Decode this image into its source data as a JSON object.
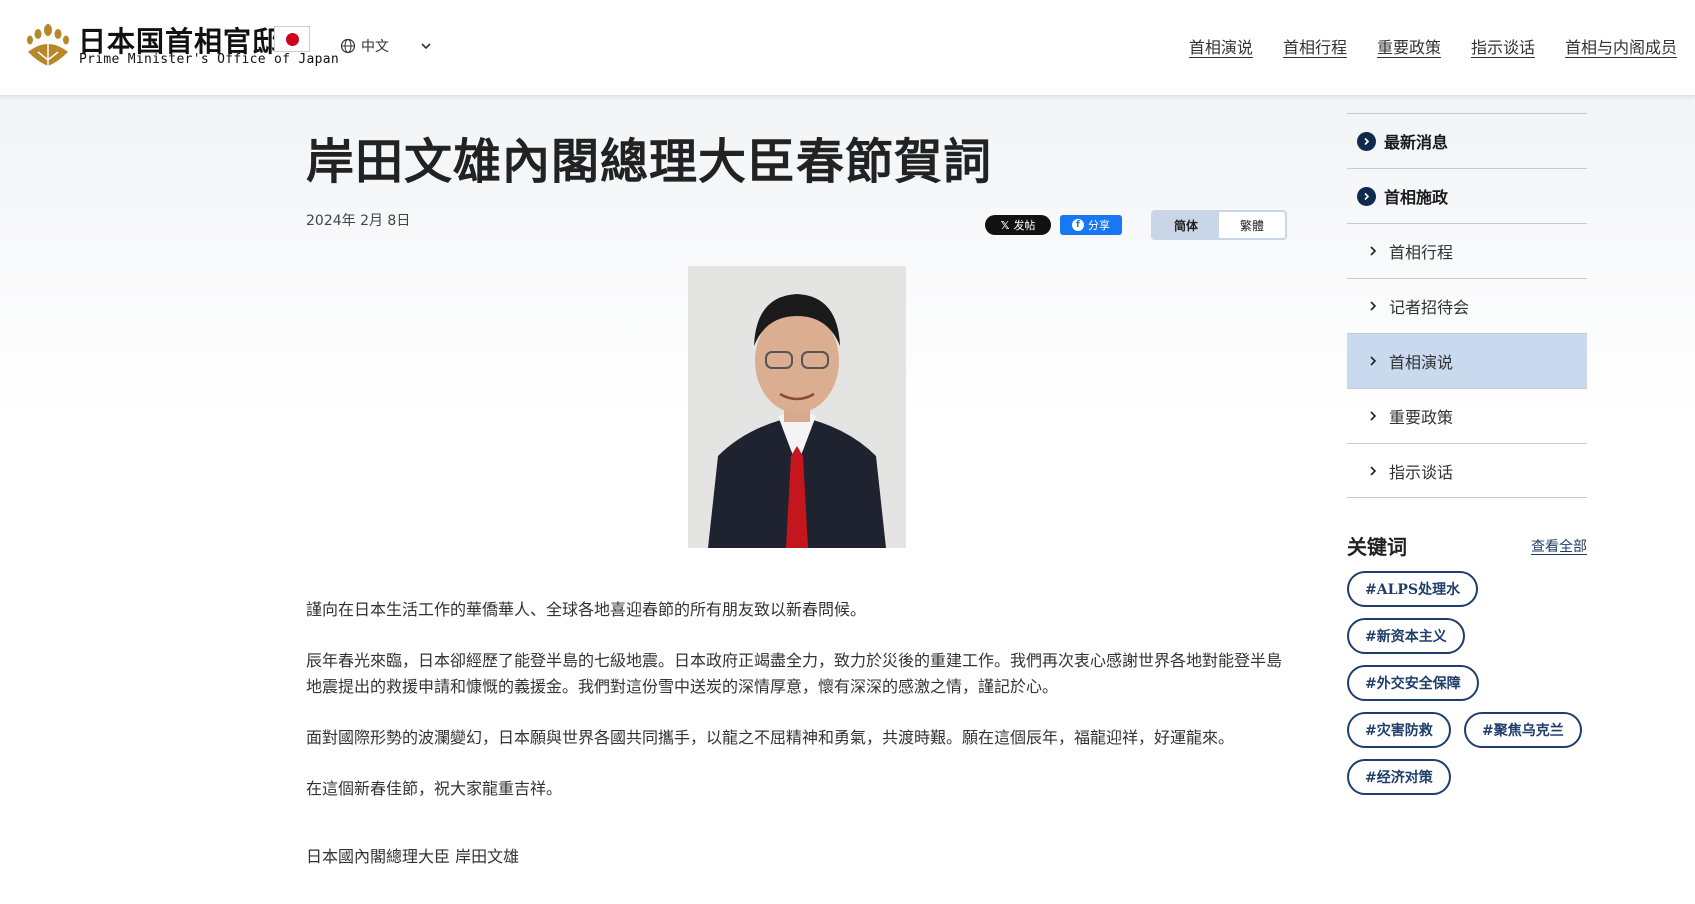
{
  "header": {
    "logo_title": "日本国首相官邸",
    "logo_subtitle": "Prime Minister's Office of Japan",
    "language": "中文",
    "nav": [
      "首相演说",
      "首相行程",
      "重要政策",
      "指示谈话",
      "首相与内阁成员"
    ]
  },
  "article": {
    "title": "岸田文雄內閣總理大臣春節賀詞",
    "date": "2024年 2月 8日",
    "share_x": "发帖",
    "share_fb": "分享",
    "script_simplified": "简体",
    "script_traditional": "繁體",
    "paragraphs": [
      "謹向在日本生活工作的華僑華人、全球各地喜迎春節的所有朋友致以新春問候。",
      "辰年春光來臨，日本卻經歷了能登半島的七級地震。日本政府正竭盡全力，致力於災後的重建工作。我們再次衷心感謝世界各地對能登半島地震提出的救援申請和慷慨的義援金。我們對這份雪中送炭的深情厚意，懷有深深的感激之情，謹記於心。",
      "面對國際形勢的波瀾變幻，日本願與世界各國共同攜手，以龍之不屈精神和勇氣，共渡時艱。願在這個辰年，福龍迎祥，好運龍來。",
      "在這個新春佳節，祝大家龍重吉祥。"
    ],
    "signature": "日本國內閣總理大臣 岸田文雄"
  },
  "sidebar": {
    "items": [
      {
        "label": "最新消息",
        "kind": "main"
      },
      {
        "label": "首相施政",
        "kind": "main"
      },
      {
        "label": "首相行程",
        "kind": "sub"
      },
      {
        "label": "记者招待会",
        "kind": "sub"
      },
      {
        "label": "首相演说",
        "kind": "sub",
        "active": true
      },
      {
        "label": "重要政策",
        "kind": "sub"
      },
      {
        "label": "指示谈话",
        "kind": "sub"
      }
    ],
    "keywords_title": "关键词",
    "keywords_all": "查看全部",
    "tags": [
      "#ALPS处理水",
      "#新资本主义",
      "#外交安全保障",
      "#灾害防救",
      "#聚焦乌克兰",
      "#经济对策"
    ]
  },
  "colors": {
    "navy": "#0f2a4a",
    "tag_border": "#1f3f6a",
    "active_bg": "#c9d9ee",
    "flag_red": "#d0021b",
    "fb_blue": "#1877f2"
  }
}
